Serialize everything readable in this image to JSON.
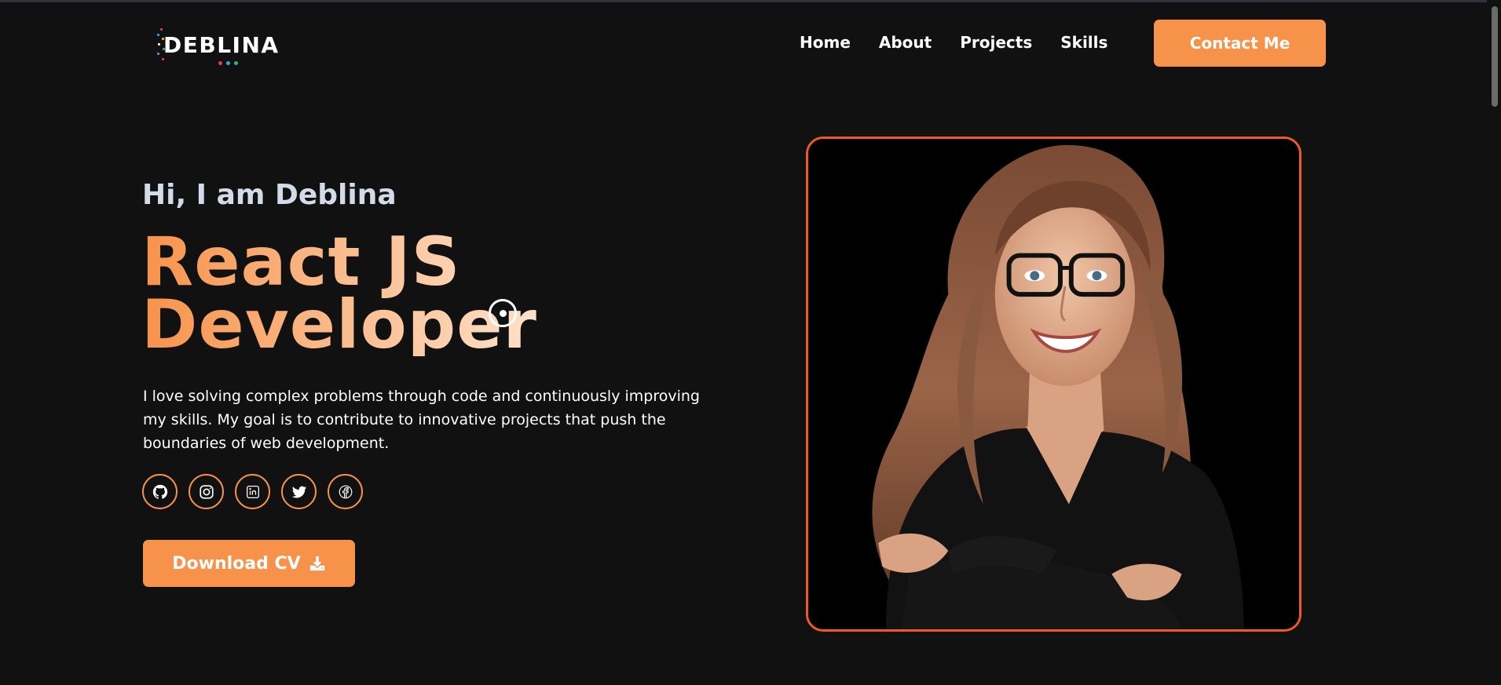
{
  "nav": {
    "logo_text": "DEBLINA",
    "links": [
      "Home",
      "About",
      "Projects",
      "Skills"
    ],
    "contact_label": "Contact Me"
  },
  "hero": {
    "greeting": "Hi, I am Deblina",
    "headline_line1": "React JS",
    "headline_line2": "Developer",
    "bio": "I love solving complex problems through code and continuously improving my skills. My goal is to contribute to innovative projects that push the boundaries of web development.",
    "socials": [
      "github-icon",
      "instagram-icon",
      "linkedin-icon",
      "twitter-icon",
      "facebook-icon"
    ],
    "download_label": "Download CV"
  },
  "colors": {
    "background": "#111111",
    "accent": "#f7924a",
    "frame_border": "#f05a22",
    "greeting_text": "#d2dbe7"
  }
}
